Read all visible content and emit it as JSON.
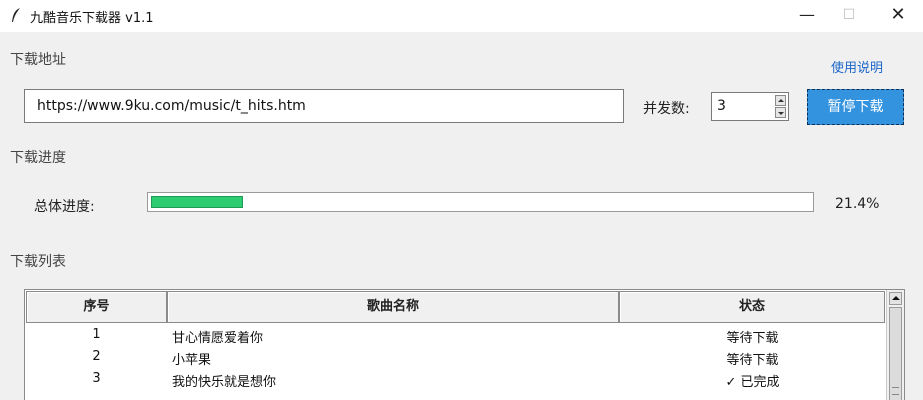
{
  "window": {
    "title": "九酷音乐下载器 v1.1",
    "minimize": "—",
    "maximize": "☐",
    "close": "✕"
  },
  "download_address": {
    "section_label": "下载地址",
    "help_link": "使用说明",
    "url_value": "https://www.9ku.com/music/t_hits.htm",
    "concurrency_label": "并发数:",
    "concurrency_value": "3",
    "pause_button": "暂停下载"
  },
  "progress": {
    "section_label": "下载进度",
    "overall_label": "总体进度:",
    "percent_text": "21.4%",
    "value": 0.214,
    "fill_color": "#2ecc71"
  },
  "download_list": {
    "section_label": "下载列表",
    "columns": [
      "序号",
      "歌曲名称",
      "状态"
    ],
    "rows": [
      {
        "index": "1",
        "name": "甘心情愿爱着你",
        "status": "等待下载"
      },
      {
        "index": "2",
        "name": "小苹果",
        "status": "等待下载"
      },
      {
        "index": "3",
        "name": "我的快乐就是想你",
        "status": "✓ 已完成"
      }
    ]
  },
  "colors": {
    "accent_button": "#3393df",
    "link": "#1a66c9",
    "progress_fill": "#2ecc71"
  }
}
